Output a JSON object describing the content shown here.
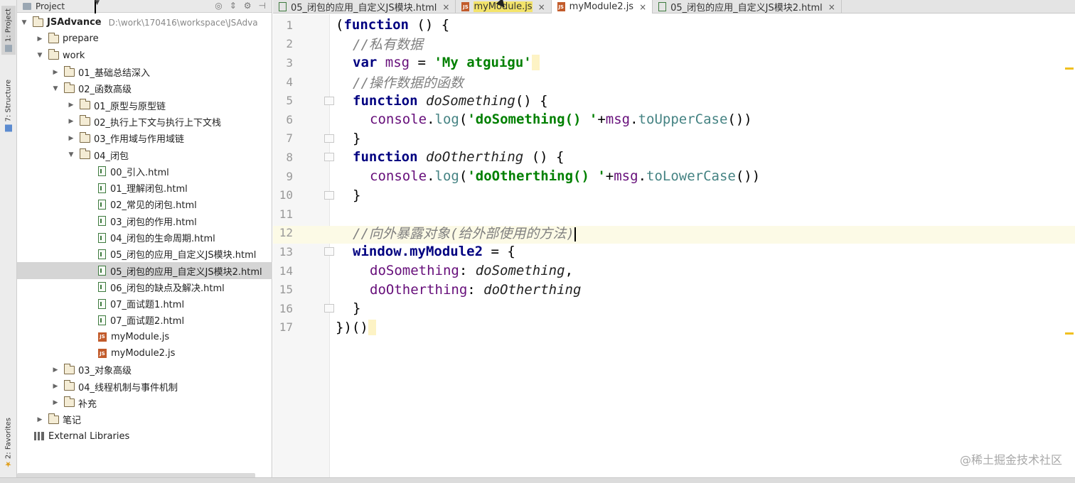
{
  "left_strip": {
    "project_tab": "1: Project",
    "structure_tab": "7: Structure",
    "favorites_tab": "2: Favorites"
  },
  "project_panel": {
    "header_label": "Project"
  },
  "tree": [
    {
      "label": "JSAdvance",
      "path": "D:\\work\\170416\\workspace\\JSAdva"
    },
    {
      "label": "prepare"
    },
    {
      "label": "work"
    },
    {
      "label": "01_基础总结深入"
    },
    {
      "label": "02_函数高级"
    },
    {
      "label": "01_原型与原型链"
    },
    {
      "label": "02_执行上下文与执行上下文栈"
    },
    {
      "label": "03_作用域与作用域链"
    },
    {
      "label": "04_闭包"
    },
    {
      "label": "00_引入.html"
    },
    {
      "label": "01_理解闭包.html"
    },
    {
      "label": "02_常见的闭包.html"
    },
    {
      "label": "03_闭包的作用.html"
    },
    {
      "label": "04_闭包的生命周期.html"
    },
    {
      "label": "05_闭包的应用_自定义JS模块.html"
    },
    {
      "label": "05_闭包的应用_自定义JS模块2.html"
    },
    {
      "label": "06_闭包的缺点及解决.html"
    },
    {
      "label": "07_面试题1.html"
    },
    {
      "label": "07_面试题2.html"
    },
    {
      "label": "myModule.js"
    },
    {
      "label": "myModule2.js"
    },
    {
      "label": "03_对象高级"
    },
    {
      "label": "04_线程机制与事件机制"
    },
    {
      "label": "补充"
    },
    {
      "label": "笔记"
    },
    {
      "label": "External Libraries"
    }
  ],
  "tabs": [
    {
      "label": "05_闭包的应用_自定义JS模块.html"
    },
    {
      "label": "myModule.js"
    },
    {
      "label": "myModule2.js"
    },
    {
      "label": "05_闭包的应用_自定义JS模块2.html"
    }
  ],
  "editor": {
    "line_numbers": [
      "1",
      "2",
      "3",
      "4",
      "5",
      "6",
      "7",
      "8",
      "9",
      "10",
      "11",
      "12",
      "13",
      "14",
      "15",
      "16",
      "17"
    ],
    "code": {
      "l1_open": "(",
      "l1_kw": "function",
      "l1_rest": " () {",
      "l2": "//私有数据",
      "l3_kw": "var",
      "l3_var": "msg",
      "l3_eq": " = ",
      "l3_str": "'My atguigu'",
      "l4": "//操作数据的函数",
      "l5_kw": "function",
      "l5_fn": "doSomething",
      "l5_rest": "() {",
      "l6_obj": "console",
      "l6_dot": ".",
      "l6_m": "log",
      "l6_p": "(",
      "l6_str": "'doSomething() '",
      "l6_plus": "+",
      "l6_var": "msg",
      "l6_dot2": ".",
      "l6_m2": "toUpperCase",
      "l6_end": "())",
      "l7": "}",
      "l8_kw": "function",
      "l8_fn": "doOtherthing",
      "l8_rest": " () {",
      "l9_obj": "console",
      "l9_dot": ".",
      "l9_m": "log",
      "l9_p": "(",
      "l9_str": "'doOtherthing() '",
      "l9_plus": "+",
      "l9_var": "msg",
      "l9_dot2": ".",
      "l9_m2": "toLowerCase",
      "l9_end": "())",
      "l10": "}",
      "l12": "//向外暴露对象(给外部使用的方法)",
      "l13_kw": "window",
      "l13_prop": ".myModule2",
      "l13_rest": " = {",
      "l14_key": "doSomething",
      "l14_colon": ": ",
      "l14_val": "doSomething",
      "l14_comma": ",",
      "l15_key": "doOtherthing",
      "l15_colon": ": ",
      "l15_val": "doOtherthing",
      "l16": "}",
      "l17": "})()"
    }
  },
  "watermark": "@稀土掘金技术社区"
}
